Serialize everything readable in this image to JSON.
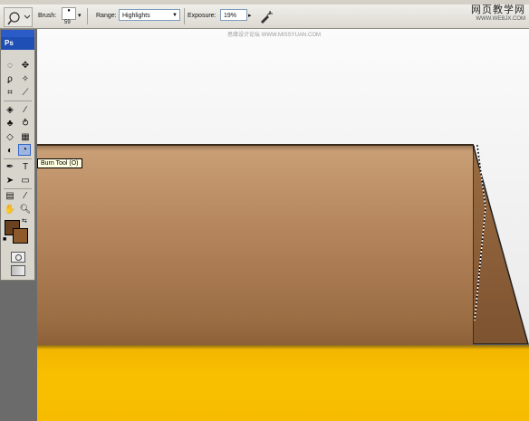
{
  "watermark": {
    "site_cn": "网页教学网",
    "site_en": "WWW.WEBJX.COM"
  },
  "canvas_watermark": "思缘设计论坛 WWW.MISSYUAN.COM",
  "options_bar": {
    "brush_label": "Brush:",
    "brush_size": "59",
    "range_label": "Range:",
    "range_value": "Highlights",
    "exposure_label": "Exposure:",
    "exposure_value": "19%"
  },
  "toolbox": {
    "logo": "Ps",
    "foreground_color": "#6b4220",
    "background_color": "#8e5a2c",
    "active_tool": "burn-tool"
  },
  "tooltip": "Burn Tool (O)",
  "colors": {
    "box_brown": "#b3835a",
    "box_yellow": "#f8bf00",
    "canvas_bg": "#f5f5f5"
  }
}
